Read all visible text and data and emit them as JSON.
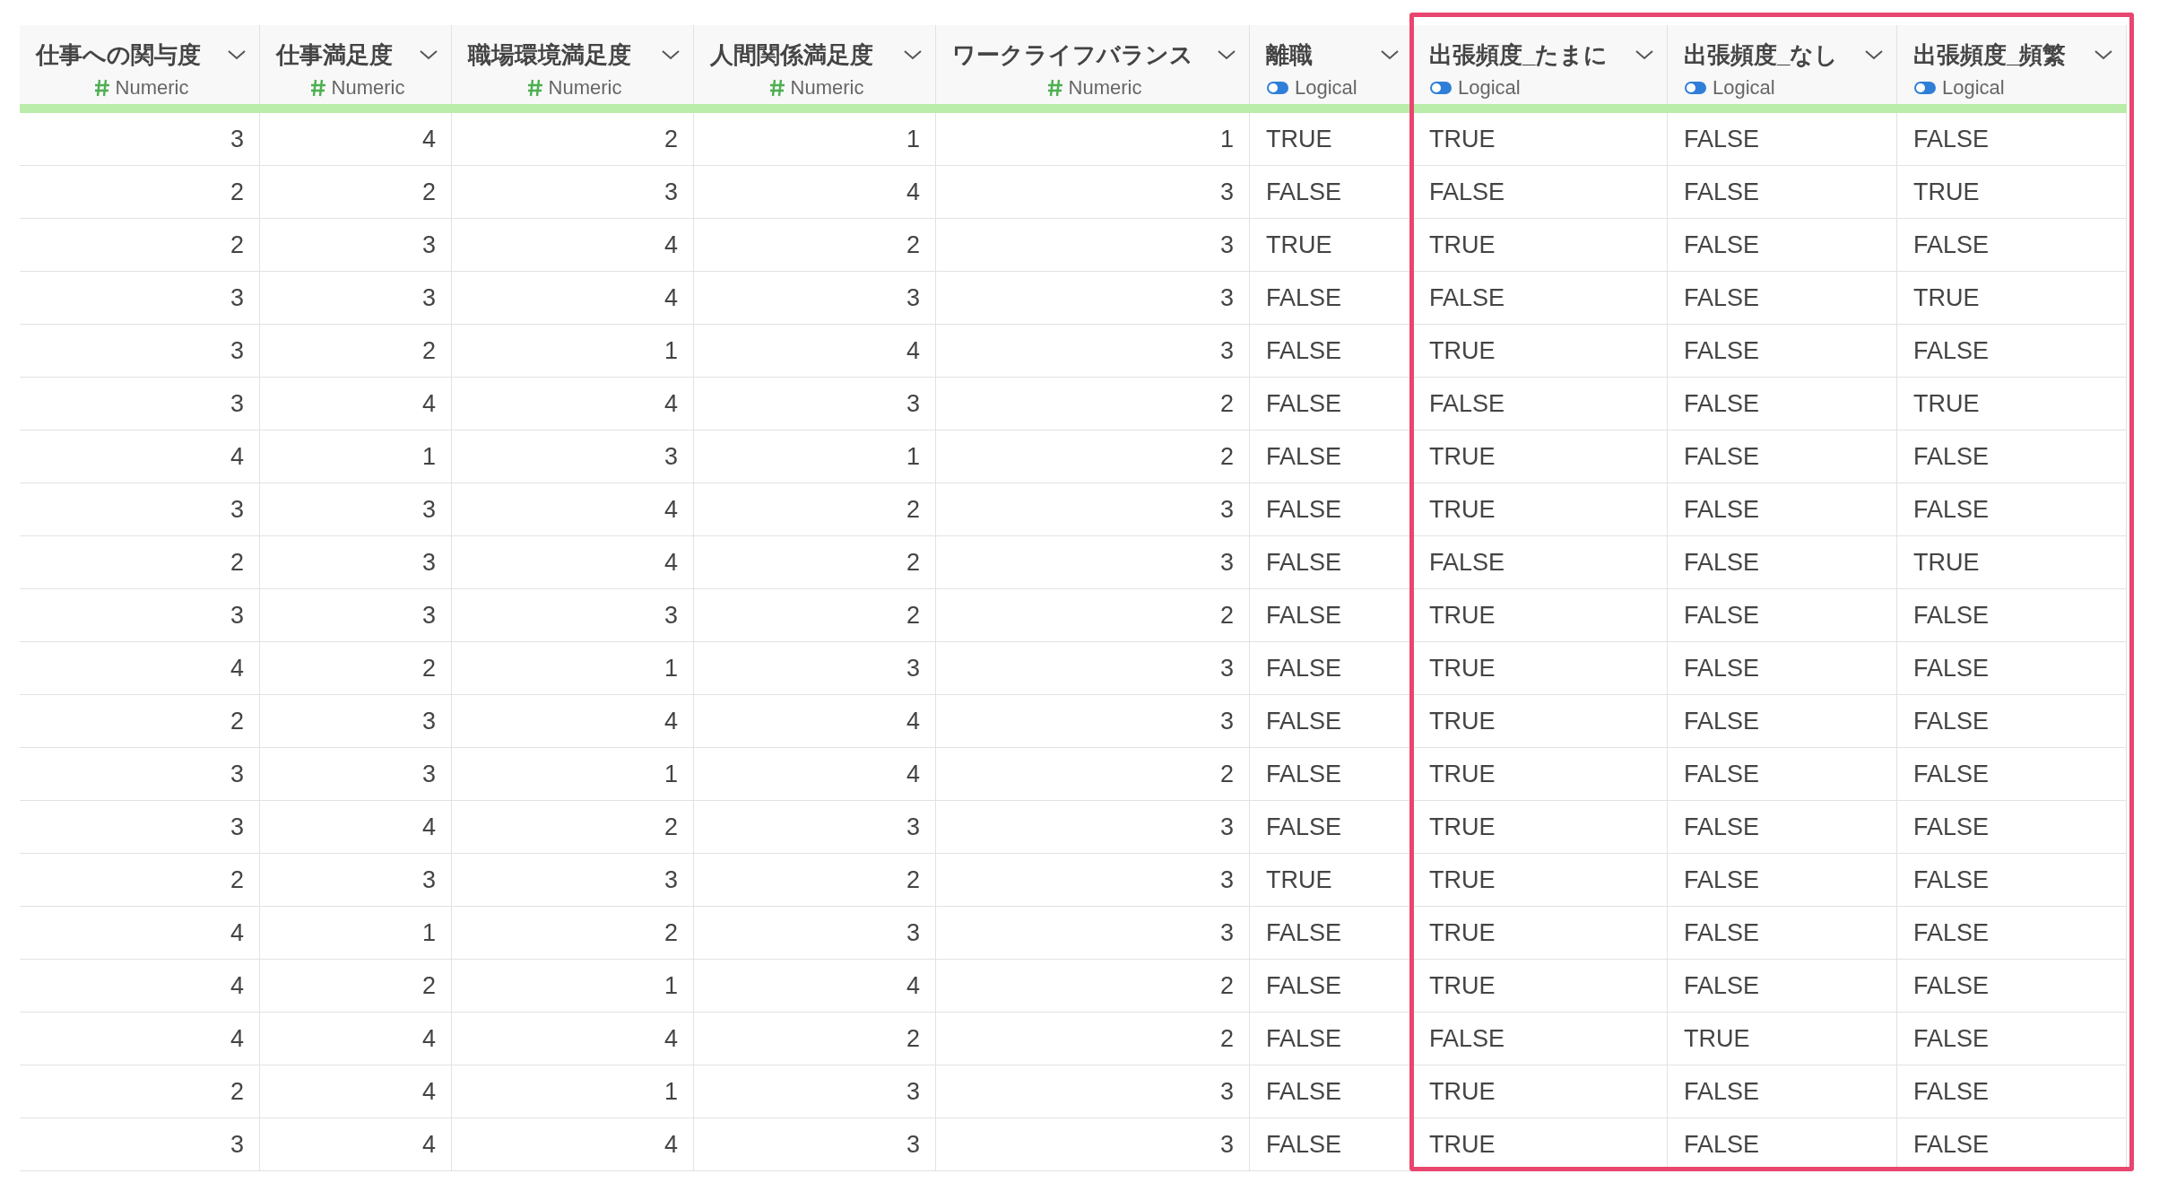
{
  "table": {
    "columns": [
      {
        "name": "仕事への関与度",
        "type": "Numeric",
        "kind": "numeric",
        "highlighted": false
      },
      {
        "name": "仕事満足度",
        "type": "Numeric",
        "kind": "numeric",
        "highlighted": false
      },
      {
        "name": "職場環境満足度",
        "type": "Numeric",
        "kind": "numeric",
        "highlighted": false
      },
      {
        "name": "人間関係満足度",
        "type": "Numeric",
        "kind": "numeric",
        "highlighted": false
      },
      {
        "name": "ワークライフバランス",
        "type": "Numeric",
        "kind": "numeric",
        "highlighted": false
      },
      {
        "name": "離職",
        "type": "Logical",
        "kind": "logical",
        "highlighted": false
      },
      {
        "name": "出張頻度_たまに",
        "type": "Logical",
        "kind": "logical",
        "highlighted": true
      },
      {
        "name": "出張頻度_なし",
        "type": "Logical",
        "kind": "logical",
        "highlighted": true
      },
      {
        "name": "出張頻度_頻繁",
        "type": "Logical",
        "kind": "logical",
        "highlighted": true
      }
    ],
    "rows": [
      [
        "3",
        "4",
        "2",
        "1",
        "1",
        "TRUE",
        "TRUE",
        "FALSE",
        "FALSE"
      ],
      [
        "2",
        "2",
        "3",
        "4",
        "3",
        "FALSE",
        "FALSE",
        "FALSE",
        "TRUE"
      ],
      [
        "2",
        "3",
        "4",
        "2",
        "3",
        "TRUE",
        "TRUE",
        "FALSE",
        "FALSE"
      ],
      [
        "3",
        "3",
        "4",
        "3",
        "3",
        "FALSE",
        "FALSE",
        "FALSE",
        "TRUE"
      ],
      [
        "3",
        "2",
        "1",
        "4",
        "3",
        "FALSE",
        "TRUE",
        "FALSE",
        "FALSE"
      ],
      [
        "3",
        "4",
        "4",
        "3",
        "2",
        "FALSE",
        "FALSE",
        "FALSE",
        "TRUE"
      ],
      [
        "4",
        "1",
        "3",
        "1",
        "2",
        "FALSE",
        "TRUE",
        "FALSE",
        "FALSE"
      ],
      [
        "3",
        "3",
        "4",
        "2",
        "3",
        "FALSE",
        "TRUE",
        "FALSE",
        "FALSE"
      ],
      [
        "2",
        "3",
        "4",
        "2",
        "3",
        "FALSE",
        "FALSE",
        "FALSE",
        "TRUE"
      ],
      [
        "3",
        "3",
        "3",
        "2",
        "2",
        "FALSE",
        "TRUE",
        "FALSE",
        "FALSE"
      ],
      [
        "4",
        "2",
        "1",
        "3",
        "3",
        "FALSE",
        "TRUE",
        "FALSE",
        "FALSE"
      ],
      [
        "2",
        "3",
        "4",
        "4",
        "3",
        "FALSE",
        "TRUE",
        "FALSE",
        "FALSE"
      ],
      [
        "3",
        "3",
        "1",
        "4",
        "2",
        "FALSE",
        "TRUE",
        "FALSE",
        "FALSE"
      ],
      [
        "3",
        "4",
        "2",
        "3",
        "3",
        "FALSE",
        "TRUE",
        "FALSE",
        "FALSE"
      ],
      [
        "2",
        "3",
        "3",
        "2",
        "3",
        "TRUE",
        "TRUE",
        "FALSE",
        "FALSE"
      ],
      [
        "4",
        "1",
        "2",
        "3",
        "3",
        "FALSE",
        "TRUE",
        "FALSE",
        "FALSE"
      ],
      [
        "4",
        "2",
        "1",
        "4",
        "2",
        "FALSE",
        "TRUE",
        "FALSE",
        "FALSE"
      ],
      [
        "4",
        "4",
        "4",
        "2",
        "2",
        "FALSE",
        "FALSE",
        "TRUE",
        "FALSE"
      ],
      [
        "2",
        "4",
        "1",
        "3",
        "3",
        "FALSE",
        "TRUE",
        "FALSE",
        "FALSE"
      ],
      [
        "3",
        "4",
        "4",
        "3",
        "3",
        "FALSE",
        "TRUE",
        "FALSE",
        "FALSE"
      ]
    ]
  }
}
